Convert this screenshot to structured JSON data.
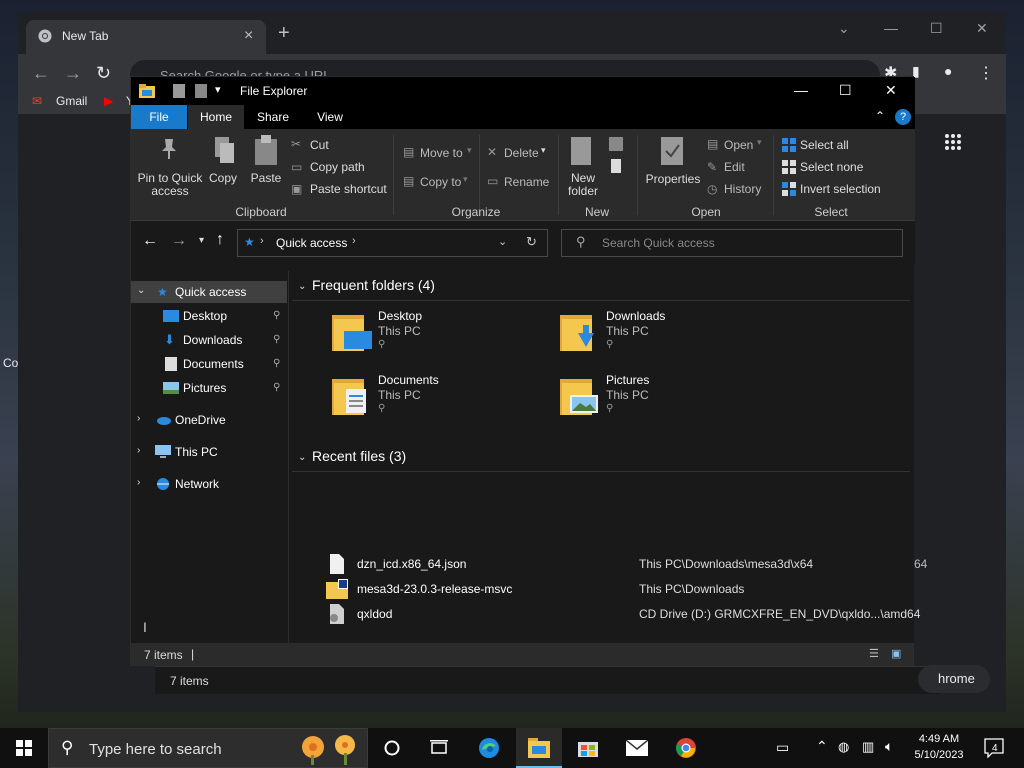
{
  "chrome": {
    "tab_title": "New Tab",
    "omnibox_placeholder": "Search Google or type a URL",
    "bookmarks": [
      "Gmail",
      "Y"
    ],
    "left_partial_text": "Co",
    "right_partial_text": "64",
    "partial_button_text": "hrome",
    "status_count": "7 items"
  },
  "explorer": {
    "title": "File Explorer",
    "ribbon_tabs": [
      "File",
      "Home",
      "Share",
      "View"
    ],
    "clipboard": {
      "pin_label": "Pin to Quick access",
      "copy_label": "Copy",
      "paste_label": "Paste",
      "cut_label": "Cut",
      "copy_path_label": "Copy path",
      "paste_shortcut_label": "Paste shortcut",
      "group_label": "Clipboard"
    },
    "organize": {
      "move_to_label": "Move to",
      "copy_to_label": "Copy to",
      "delete_label": "Delete",
      "rename_label": "Rename",
      "group_label": "Organize"
    },
    "new": {
      "new_folder_label": "New folder",
      "group_label": "New"
    },
    "open": {
      "properties_label": "Properties",
      "open_label": "Open",
      "edit_label": "Edit",
      "history_label": "History",
      "group_label": "Open"
    },
    "select": {
      "select_all_label": "Select all",
      "select_none_label": "Select none",
      "invert_label": "Invert selection",
      "group_label": "Select"
    },
    "address_crumb": "Quick access",
    "search_placeholder": "Search Quick access",
    "nav": {
      "quick_access": "Quick access",
      "desktop": "Desktop",
      "downloads": "Downloads",
      "documents": "Documents",
      "pictures": "Pictures",
      "onedrive": "OneDrive",
      "this_pc": "This PC",
      "network": "Network"
    },
    "frequent_header": "Frequent folders (4)",
    "folders": [
      {
        "name": "Desktop",
        "location": "This PC"
      },
      {
        "name": "Downloads",
        "location": "This PC"
      },
      {
        "name": "Documents",
        "location": "This PC"
      },
      {
        "name": "Pictures",
        "location": "This PC"
      }
    ],
    "recent_header": "Recent files (3)",
    "recent_files": [
      {
        "name": "dzn_icd.x86_64.json",
        "location": "This PC\\Downloads\\mesa3d\\x64"
      },
      {
        "name": "mesa3d-23.0.3-release-msvc",
        "location": "This PC\\Downloads"
      },
      {
        "name": "qxldod",
        "location": "CD Drive (D:) GRMCXFRE_EN_DVD\\qxldo...\\amd64"
      }
    ],
    "status_count": "7 items"
  },
  "taskbar": {
    "search_placeholder": "Type here to search",
    "time": "4:49 AM",
    "date": "5/10/2023",
    "notification_count": "4"
  },
  "colors": {
    "accent": "#1979ca",
    "folder": "#f4c74f",
    "taskbar_active": "#76b9ed"
  }
}
